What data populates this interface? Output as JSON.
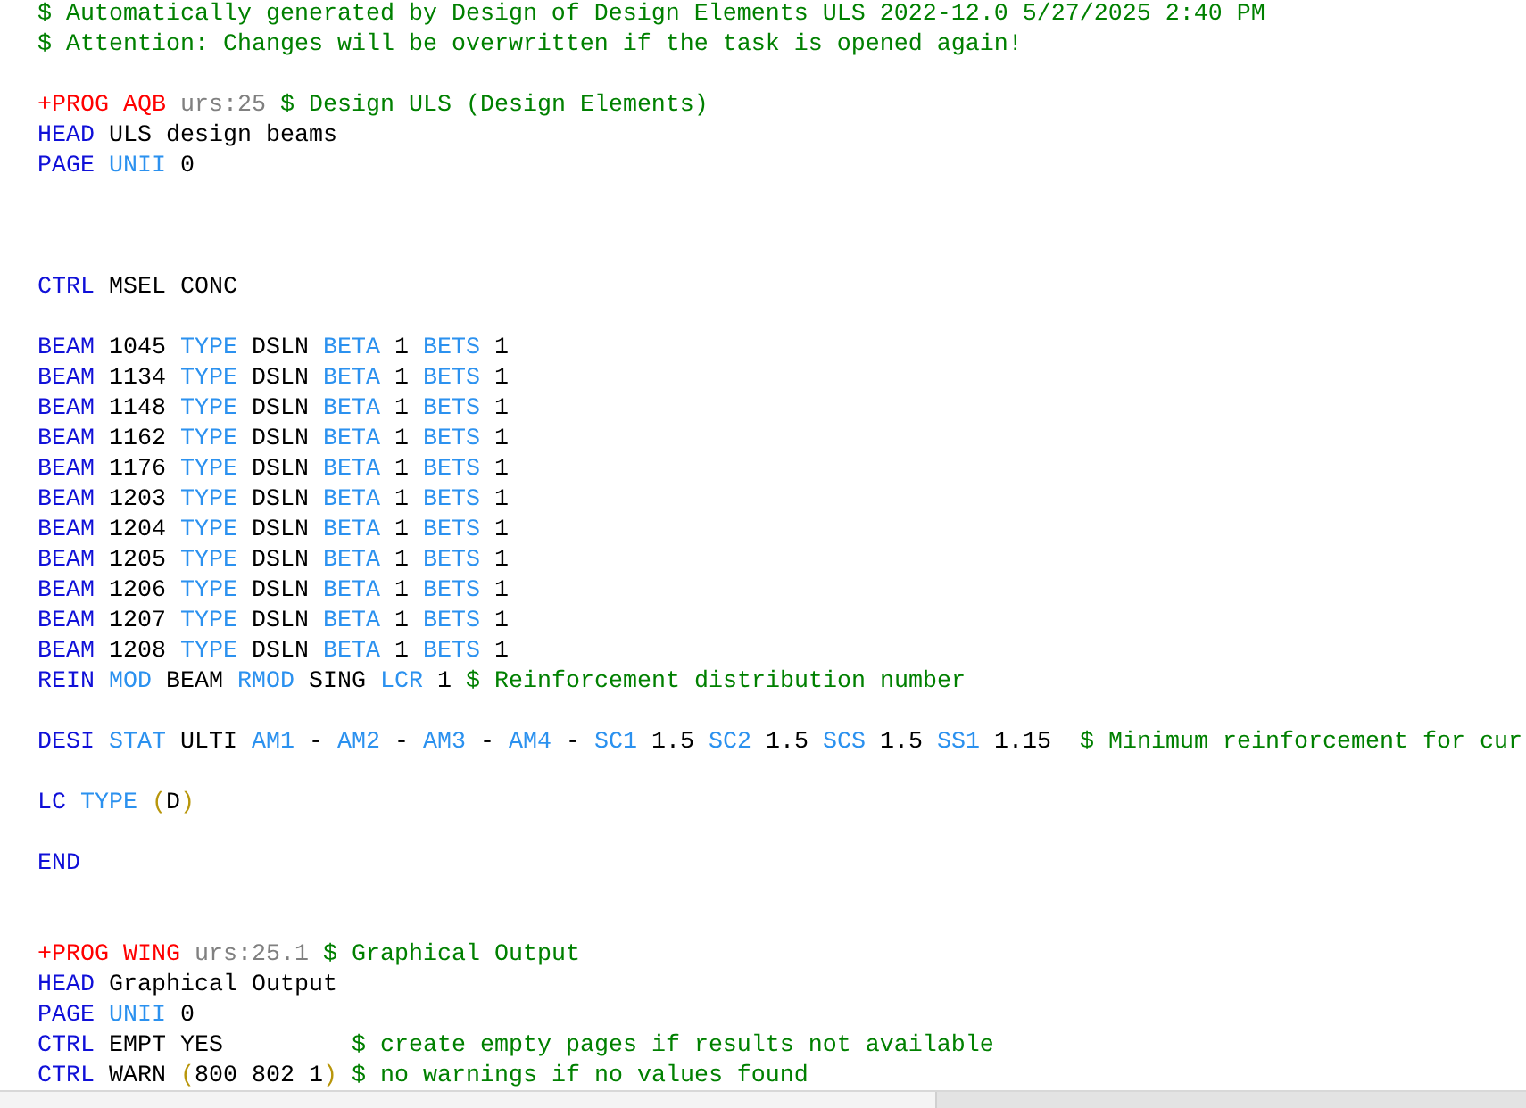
{
  "editor": {
    "lines": [
      {
        "kind": "code",
        "tokens": [
          {
            "kind": "comment",
            "text": "$ Automatically generated by Design of Design Elements ULS 2022-12.0 5/27/2025 2:40 PM"
          }
        ]
      },
      {
        "kind": "code",
        "tokens": [
          {
            "kind": "comment",
            "text": "$ Attention: Changes will be overwritten if the task is opened again!"
          }
        ]
      },
      {
        "kind": "blank"
      },
      {
        "kind": "code",
        "tokens": [
          {
            "kind": "program",
            "text": "+PROG AQB "
          },
          {
            "kind": "version",
            "text": "urs:25 "
          },
          {
            "kind": "comment",
            "text": "$ Design ULS (Design Elements)"
          }
        ]
      },
      {
        "kind": "code",
        "tokens": [
          {
            "kind": "keyword",
            "text": "HEAD "
          },
          {
            "kind": "value",
            "text": "ULS design beams"
          }
        ]
      },
      {
        "kind": "code",
        "tokens": [
          {
            "kind": "keyword",
            "text": "PAGE "
          },
          {
            "kind": "param",
            "text": "UNII "
          },
          {
            "kind": "value",
            "text": "0"
          }
        ]
      },
      {
        "kind": "blank"
      },
      {
        "kind": "blank"
      },
      {
        "kind": "blank"
      },
      {
        "kind": "code",
        "tokens": [
          {
            "kind": "keyword",
            "text": "CTRL "
          },
          {
            "kind": "value",
            "text": "MSEL CONC"
          }
        ]
      },
      {
        "kind": "blank"
      },
      {
        "kind": "code",
        "tokens": [
          {
            "kind": "keyword",
            "text": "BEAM "
          },
          {
            "kind": "value",
            "text": "1045 "
          },
          {
            "kind": "param",
            "text": "TYPE "
          },
          {
            "kind": "value",
            "text": "DSLN "
          },
          {
            "kind": "param",
            "text": "BETA "
          },
          {
            "kind": "value",
            "text": "1 "
          },
          {
            "kind": "param",
            "text": "BETS "
          },
          {
            "kind": "value",
            "text": "1"
          }
        ]
      },
      {
        "kind": "code",
        "tokens": [
          {
            "kind": "keyword",
            "text": "BEAM "
          },
          {
            "kind": "value",
            "text": "1134 "
          },
          {
            "kind": "param",
            "text": "TYPE "
          },
          {
            "kind": "value",
            "text": "DSLN "
          },
          {
            "kind": "param",
            "text": "BETA "
          },
          {
            "kind": "value",
            "text": "1 "
          },
          {
            "kind": "param",
            "text": "BETS "
          },
          {
            "kind": "value",
            "text": "1"
          }
        ]
      },
      {
        "kind": "code",
        "tokens": [
          {
            "kind": "keyword",
            "text": "BEAM "
          },
          {
            "kind": "value",
            "text": "1148 "
          },
          {
            "kind": "param",
            "text": "TYPE "
          },
          {
            "kind": "value",
            "text": "DSLN "
          },
          {
            "kind": "param",
            "text": "BETA "
          },
          {
            "kind": "value",
            "text": "1 "
          },
          {
            "kind": "param",
            "text": "BETS "
          },
          {
            "kind": "value",
            "text": "1"
          }
        ]
      },
      {
        "kind": "code",
        "tokens": [
          {
            "kind": "keyword",
            "text": "BEAM "
          },
          {
            "kind": "value",
            "text": "1162 "
          },
          {
            "kind": "param",
            "text": "TYPE "
          },
          {
            "kind": "value",
            "text": "DSLN "
          },
          {
            "kind": "param",
            "text": "BETA "
          },
          {
            "kind": "value",
            "text": "1 "
          },
          {
            "kind": "param",
            "text": "BETS "
          },
          {
            "kind": "value",
            "text": "1"
          }
        ]
      },
      {
        "kind": "code",
        "tokens": [
          {
            "kind": "keyword",
            "text": "BEAM "
          },
          {
            "kind": "value",
            "text": "1176 "
          },
          {
            "kind": "param",
            "text": "TYPE "
          },
          {
            "kind": "value",
            "text": "DSLN "
          },
          {
            "kind": "param",
            "text": "BETA "
          },
          {
            "kind": "value",
            "text": "1 "
          },
          {
            "kind": "param",
            "text": "BETS "
          },
          {
            "kind": "value",
            "text": "1"
          }
        ]
      },
      {
        "kind": "code",
        "tokens": [
          {
            "kind": "keyword",
            "text": "BEAM "
          },
          {
            "kind": "value",
            "text": "1203 "
          },
          {
            "kind": "param",
            "text": "TYPE "
          },
          {
            "kind": "value",
            "text": "DSLN "
          },
          {
            "kind": "param",
            "text": "BETA "
          },
          {
            "kind": "value",
            "text": "1 "
          },
          {
            "kind": "param",
            "text": "BETS "
          },
          {
            "kind": "value",
            "text": "1"
          }
        ]
      },
      {
        "kind": "code",
        "tokens": [
          {
            "kind": "keyword",
            "text": "BEAM "
          },
          {
            "kind": "value",
            "text": "1204 "
          },
          {
            "kind": "param",
            "text": "TYPE "
          },
          {
            "kind": "value",
            "text": "DSLN "
          },
          {
            "kind": "param",
            "text": "BETA "
          },
          {
            "kind": "value",
            "text": "1 "
          },
          {
            "kind": "param",
            "text": "BETS "
          },
          {
            "kind": "value",
            "text": "1"
          }
        ]
      },
      {
        "kind": "code",
        "tokens": [
          {
            "kind": "keyword",
            "text": "BEAM "
          },
          {
            "kind": "value",
            "text": "1205 "
          },
          {
            "kind": "param",
            "text": "TYPE "
          },
          {
            "kind": "value",
            "text": "DSLN "
          },
          {
            "kind": "param",
            "text": "BETA "
          },
          {
            "kind": "value",
            "text": "1 "
          },
          {
            "kind": "param",
            "text": "BETS "
          },
          {
            "kind": "value",
            "text": "1"
          }
        ]
      },
      {
        "kind": "code",
        "tokens": [
          {
            "kind": "keyword",
            "text": "BEAM "
          },
          {
            "kind": "value",
            "text": "1206 "
          },
          {
            "kind": "param",
            "text": "TYPE "
          },
          {
            "kind": "value",
            "text": "DSLN "
          },
          {
            "kind": "param",
            "text": "BETA "
          },
          {
            "kind": "value",
            "text": "1 "
          },
          {
            "kind": "param",
            "text": "BETS "
          },
          {
            "kind": "value",
            "text": "1"
          }
        ]
      },
      {
        "kind": "code",
        "tokens": [
          {
            "kind": "keyword",
            "text": "BEAM "
          },
          {
            "kind": "value",
            "text": "1207 "
          },
          {
            "kind": "param",
            "text": "TYPE "
          },
          {
            "kind": "value",
            "text": "DSLN "
          },
          {
            "kind": "param",
            "text": "BETA "
          },
          {
            "kind": "value",
            "text": "1 "
          },
          {
            "kind": "param",
            "text": "BETS "
          },
          {
            "kind": "value",
            "text": "1"
          }
        ]
      },
      {
        "kind": "code",
        "tokens": [
          {
            "kind": "keyword",
            "text": "BEAM "
          },
          {
            "kind": "value",
            "text": "1208 "
          },
          {
            "kind": "param",
            "text": "TYPE "
          },
          {
            "kind": "value",
            "text": "DSLN "
          },
          {
            "kind": "param",
            "text": "BETA "
          },
          {
            "kind": "value",
            "text": "1 "
          },
          {
            "kind": "param",
            "text": "BETS "
          },
          {
            "kind": "value",
            "text": "1"
          }
        ]
      },
      {
        "kind": "code",
        "tokens": [
          {
            "kind": "keyword",
            "text": "REIN "
          },
          {
            "kind": "param",
            "text": "MOD "
          },
          {
            "kind": "value",
            "text": "BEAM "
          },
          {
            "kind": "param",
            "text": "RMOD "
          },
          {
            "kind": "value",
            "text": "SING "
          },
          {
            "kind": "param",
            "text": "LCR "
          },
          {
            "kind": "value",
            "text": "1 "
          },
          {
            "kind": "comment",
            "text": "$ Reinforcement distribution number"
          }
        ]
      },
      {
        "kind": "blank"
      },
      {
        "kind": "code",
        "tokens": [
          {
            "kind": "keyword",
            "text": "DESI "
          },
          {
            "kind": "param",
            "text": "STAT "
          },
          {
            "kind": "value",
            "text": "ULTI "
          },
          {
            "kind": "param",
            "text": "AM1 "
          },
          {
            "kind": "value",
            "text": "- "
          },
          {
            "kind": "param",
            "text": "AM2 "
          },
          {
            "kind": "value",
            "text": "- "
          },
          {
            "kind": "param",
            "text": "AM3 "
          },
          {
            "kind": "value",
            "text": "- "
          },
          {
            "kind": "param",
            "text": "AM4 "
          },
          {
            "kind": "value",
            "text": "- "
          },
          {
            "kind": "param",
            "text": "SC1 "
          },
          {
            "kind": "value",
            "text": "1.5 "
          },
          {
            "kind": "param",
            "text": "SC2 "
          },
          {
            "kind": "value",
            "text": "1.5 "
          },
          {
            "kind": "param",
            "text": "SCS "
          },
          {
            "kind": "value",
            "text": "1.5 "
          },
          {
            "kind": "param",
            "text": "SS1 "
          },
          {
            "kind": "value",
            "text": "1.15  "
          },
          {
            "kind": "comment",
            "text": "$ Minimum reinforcement for cur"
          }
        ]
      },
      {
        "kind": "blank"
      },
      {
        "kind": "code",
        "tokens": [
          {
            "kind": "keyword",
            "text": "LC "
          },
          {
            "kind": "param",
            "text": "TYPE "
          },
          {
            "kind": "bracket",
            "text": "("
          },
          {
            "kind": "value",
            "text": "D"
          },
          {
            "kind": "bracket",
            "text": ")"
          }
        ]
      },
      {
        "kind": "blank"
      },
      {
        "kind": "code",
        "tokens": [
          {
            "kind": "keyword",
            "text": "END"
          }
        ]
      },
      {
        "kind": "blank"
      },
      {
        "kind": "blank"
      },
      {
        "kind": "code",
        "tokens": [
          {
            "kind": "program",
            "text": "+PROG WING "
          },
          {
            "kind": "version",
            "text": "urs:25.1 "
          },
          {
            "kind": "comment",
            "text": "$ Graphical Output"
          }
        ]
      },
      {
        "kind": "code",
        "tokens": [
          {
            "kind": "keyword",
            "text": "HEAD "
          },
          {
            "kind": "value",
            "text": "Graphical Output"
          }
        ]
      },
      {
        "kind": "code",
        "tokens": [
          {
            "kind": "keyword",
            "text": "PAGE "
          },
          {
            "kind": "param",
            "text": "UNII "
          },
          {
            "kind": "value",
            "text": "0"
          }
        ]
      },
      {
        "kind": "code",
        "tokens": [
          {
            "kind": "keyword",
            "text": "CTRL "
          },
          {
            "kind": "value",
            "text": "EMPT YES         "
          },
          {
            "kind": "comment",
            "text": "$ create empty pages if results not available"
          }
        ]
      },
      {
        "kind": "code",
        "tokens": [
          {
            "kind": "keyword",
            "text": "CTRL "
          },
          {
            "kind": "value",
            "text": "WARN "
          },
          {
            "kind": "bracket",
            "text": "("
          },
          {
            "kind": "value",
            "text": "800 802 1"
          },
          {
            "kind": "bracket",
            "text": ") "
          },
          {
            "kind": "comment",
            "text": "$ no warnings if no values found"
          }
        ]
      }
    ]
  }
}
